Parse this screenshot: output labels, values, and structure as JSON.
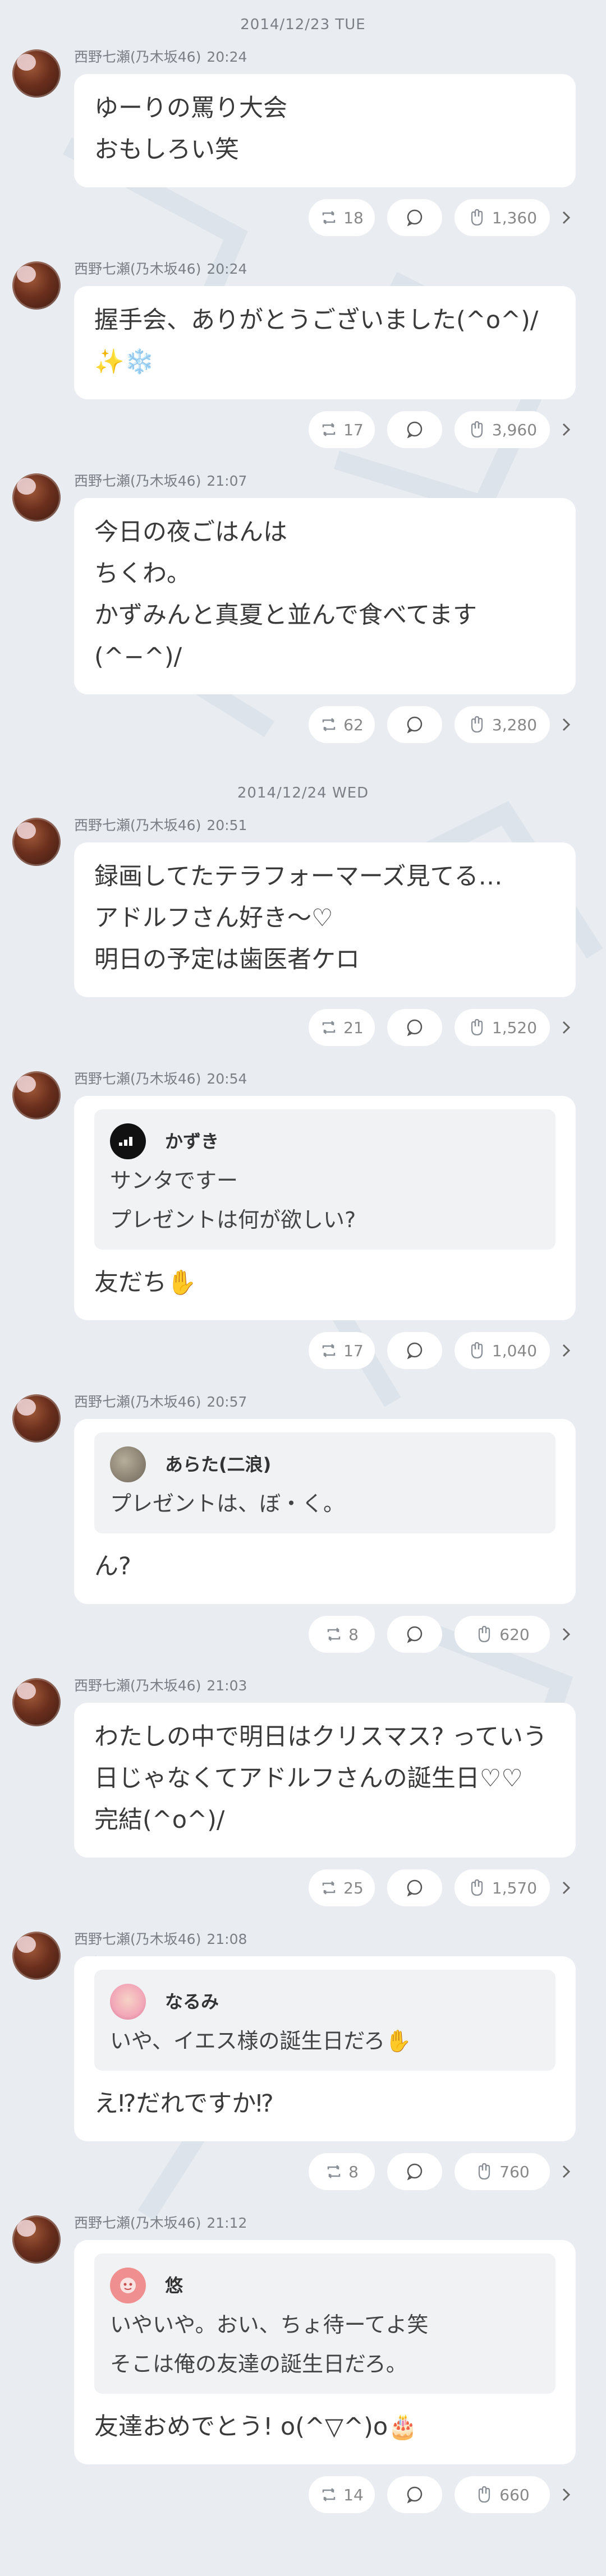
{
  "author": {
    "name": "西野七瀬(乃木坂46)"
  },
  "dates": {
    "d1": "2014/12/23 TUE",
    "d2": "2014/12/24 WED"
  },
  "icons": {
    "retweet": "retweet-icon",
    "comment": "comment-icon",
    "like": "clap-icon",
    "more": "chevron-right-icon"
  },
  "posts": [
    {
      "time": "20:24",
      "lines": [
        "ゆーりの罵り大会",
        "おもしろい笑"
      ],
      "rt": "18",
      "likes": "1,360"
    },
    {
      "time": "20:24",
      "lines": [
        "握手会、ありがとうございました(^o^)/",
        "✨❄️"
      ],
      "rt": "17",
      "likes": "3,960"
    },
    {
      "time": "21:07",
      "lines": [
        "今日の夜ごはんは",
        "ちくわ。",
        "かずみんと真夏と並んで食べてます",
        "(^−^)/"
      ],
      "rt": "62",
      "likes": "3,280"
    },
    {
      "time": "20:51",
      "lines": [
        "録画してたテラフォーマーズ見てる…",
        "アドルフさん好き〜♡",
        "明日の予定は歯医者ケロ"
      ],
      "rt": "21",
      "likes": "1,520"
    },
    {
      "time": "20:54",
      "quote": {
        "name": "かずき",
        "lines": [
          "サンタですー",
          "プレゼントは何が欲しい?"
        ]
      },
      "lines": [
        "友だち✋"
      ],
      "rt": "17",
      "likes": "1,040"
    },
    {
      "time": "20:57",
      "quote": {
        "name": "あらた(二浪)",
        "lines": [
          "プレゼントは、ぼ・く。"
        ]
      },
      "lines": [
        "ん?"
      ],
      "rt": "8",
      "likes": "620"
    },
    {
      "time": "21:03",
      "lines": [
        "わたしの中で明日はクリスマス? っていう",
        "日じゃなくてアドルフさんの誕生日♡♡",
        "完結(^o^)/"
      ],
      "rt": "25",
      "likes": "1,570"
    },
    {
      "time": "21:08",
      "quote": {
        "name": "なるみ",
        "lines": [
          "いや、イエス様の誕生日だろ✋"
        ]
      },
      "lines": [
        "え⁉だれですか⁉"
      ],
      "rt": "8",
      "likes": "760"
    },
    {
      "time": "21:12",
      "quote": {
        "name": "悠",
        "lines": [
          "いやいや。おい、ちょ待ーてよ笑",
          "そこは俺の友達の誕生日だろ。"
        ]
      },
      "lines": [
        "友達おめでとう! o(^▽^)o🎂"
      ],
      "rt": "14",
      "likes": "660"
    }
  ]
}
